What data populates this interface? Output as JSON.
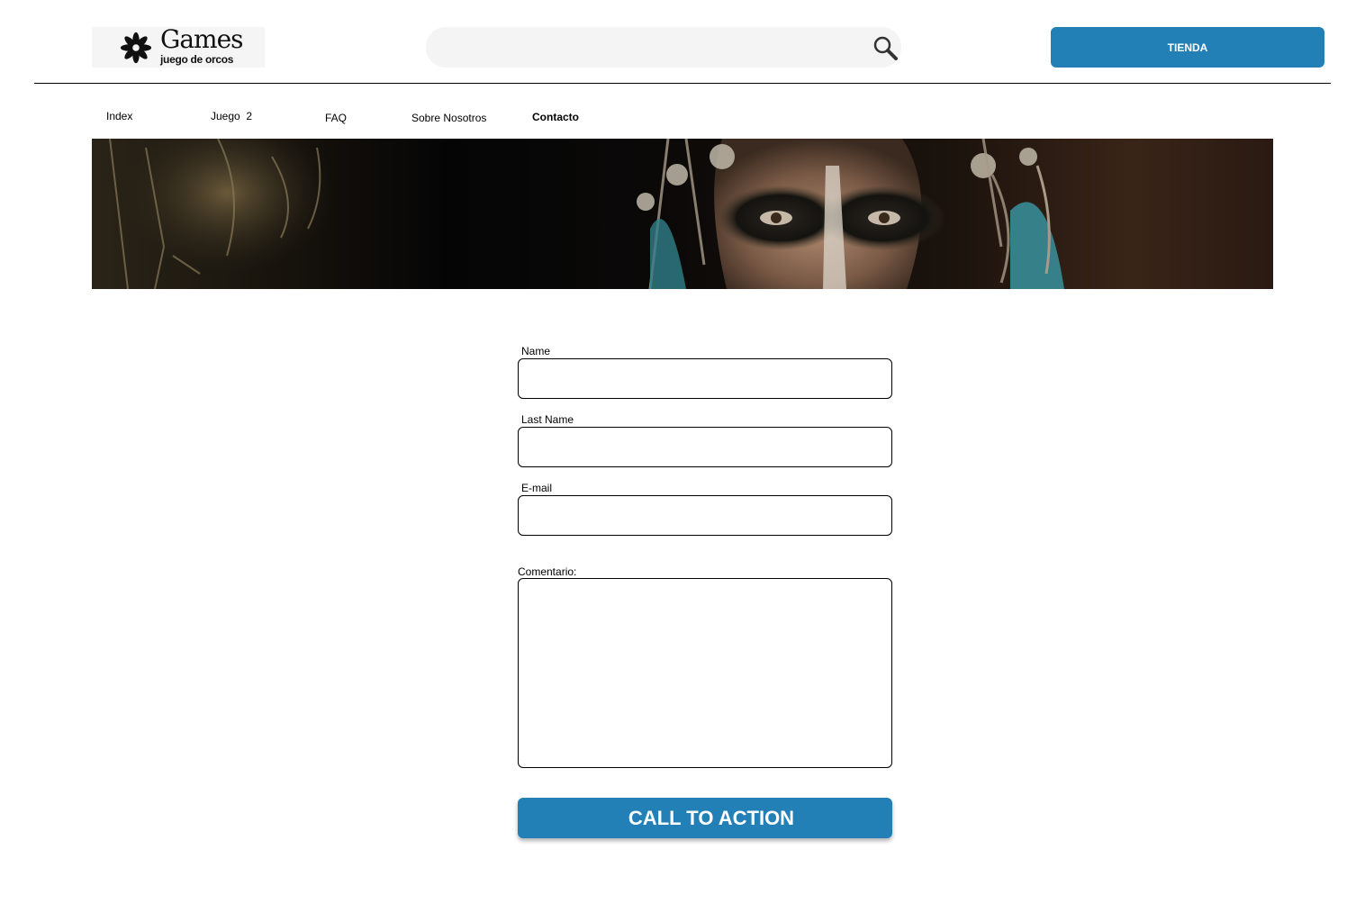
{
  "header": {
    "logo": {
      "brand": "Games",
      "tagline": "juego de orcos",
      "icon": "flower-logo-icon"
    },
    "search": {
      "placeholder": "",
      "value": "",
      "icon": "search-icon"
    },
    "store_button": "TIENDA"
  },
  "nav": {
    "items": [
      {
        "label": "Index",
        "active": false
      },
      {
        "label": "Juego  2",
        "active": false
      },
      {
        "label": "FAQ",
        "active": false
      },
      {
        "label": "Sobre Nosotros",
        "active": false
      },
      {
        "label": "Contacto",
        "active": true
      }
    ]
  },
  "banner": {
    "description_icon": "orc-warrior-banner-image"
  },
  "form": {
    "name_label": "Name",
    "name_value": "",
    "last_name_label": "Last Name",
    "last_name_value": "",
    "email_label": "E-mail",
    "email_value": "",
    "comment_label": "Comentario:",
    "comment_value": "",
    "submit_label": "CALL TO ACTION"
  },
  "colors": {
    "accent": "#2280b6",
    "search_bg": "#f4f4f4"
  }
}
